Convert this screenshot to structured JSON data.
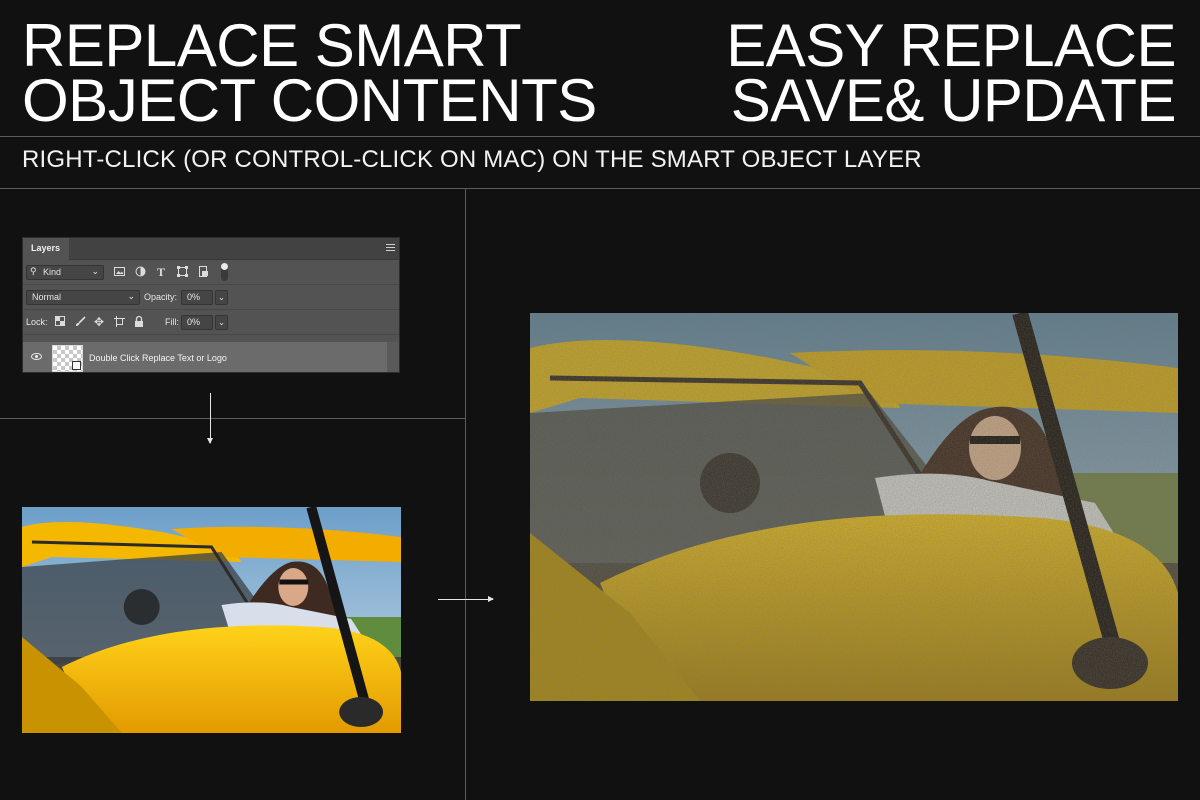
{
  "headline_left": {
    "line1": "REPLACE SMART",
    "line2": "OBJECT CONTENTS"
  },
  "headline_right": {
    "line1": "EASY REPLACE",
    "line2": "SAVE& UPDATE"
  },
  "instruction": "RIGHT-CLICK (OR CONTROL-CLICK ON MAC) ON THE SMART OBJECT LAYER",
  "layers_panel": {
    "tab_label": "Layers",
    "filter_kind": "Kind",
    "blend_mode": "Normal",
    "opacity_label": "Opacity:",
    "opacity_value": "0%",
    "lock_label": "Lock:",
    "fill_label": "Fill:",
    "fill_value": "0%",
    "layer_name": "Double Click Replace Text or Logo"
  },
  "colors": {
    "background": "#111111",
    "rule": "#5c5c5c",
    "panel": "#535353",
    "plane_yellow": "#f2b705",
    "sky": "#7da9cc"
  },
  "icons": [
    "search-icon",
    "image-filter-icon",
    "adjustment-filter-icon",
    "type-filter-icon",
    "shape-filter-icon",
    "smart-object-filter-icon",
    "filter-toggle-icon",
    "panel-menu-icon",
    "eye-icon",
    "lock-transparent-icon",
    "lock-paint-icon",
    "lock-move-icon",
    "lock-artboard-icon",
    "lock-all-icon",
    "arrow-down-icon",
    "arrow-right-icon"
  ]
}
